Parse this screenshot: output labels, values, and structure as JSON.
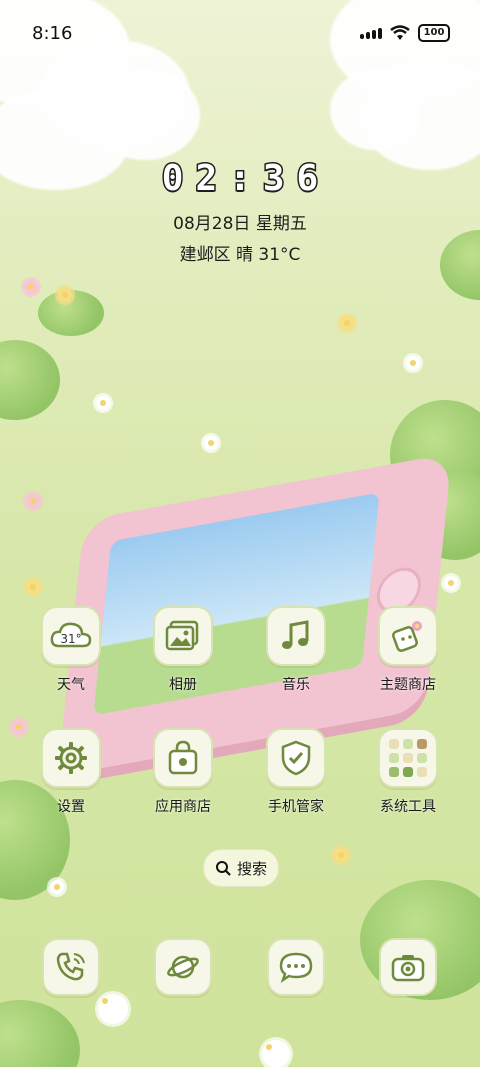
{
  "status_bar": {
    "time": "8:16",
    "battery": "100"
  },
  "clock": {
    "digits": [
      "0",
      "2",
      ":",
      "3",
      "6"
    ],
    "date": "08月28日 星期五",
    "weather": "建邺区 晴 31°C"
  },
  "apps": [
    {
      "label": "天气",
      "icon": "weather-icon",
      "icon_text": "31°"
    },
    {
      "label": "相册",
      "icon": "gallery-icon"
    },
    {
      "label": "音乐",
      "icon": "music-icon"
    },
    {
      "label": "主题商店",
      "icon": "theme-store-icon"
    },
    {
      "label": "设置",
      "icon": "settings-icon"
    },
    {
      "label": "应用商店",
      "icon": "app-store-icon"
    },
    {
      "label": "手机管家",
      "icon": "phone-manager-icon"
    },
    {
      "label": "系统工具",
      "icon": "system-tools-folder-icon"
    }
  ],
  "search": {
    "label": "搜索"
  },
  "dock": [
    {
      "icon": "phone-icon"
    },
    {
      "icon": "browser-icon"
    },
    {
      "icon": "messages-icon"
    },
    {
      "icon": "camera-icon"
    }
  ],
  "colors": {
    "icon_stroke": "#6f8a3c",
    "tile_bg": "#f6f7e8",
    "accent_pink": "#f2c4d2"
  }
}
